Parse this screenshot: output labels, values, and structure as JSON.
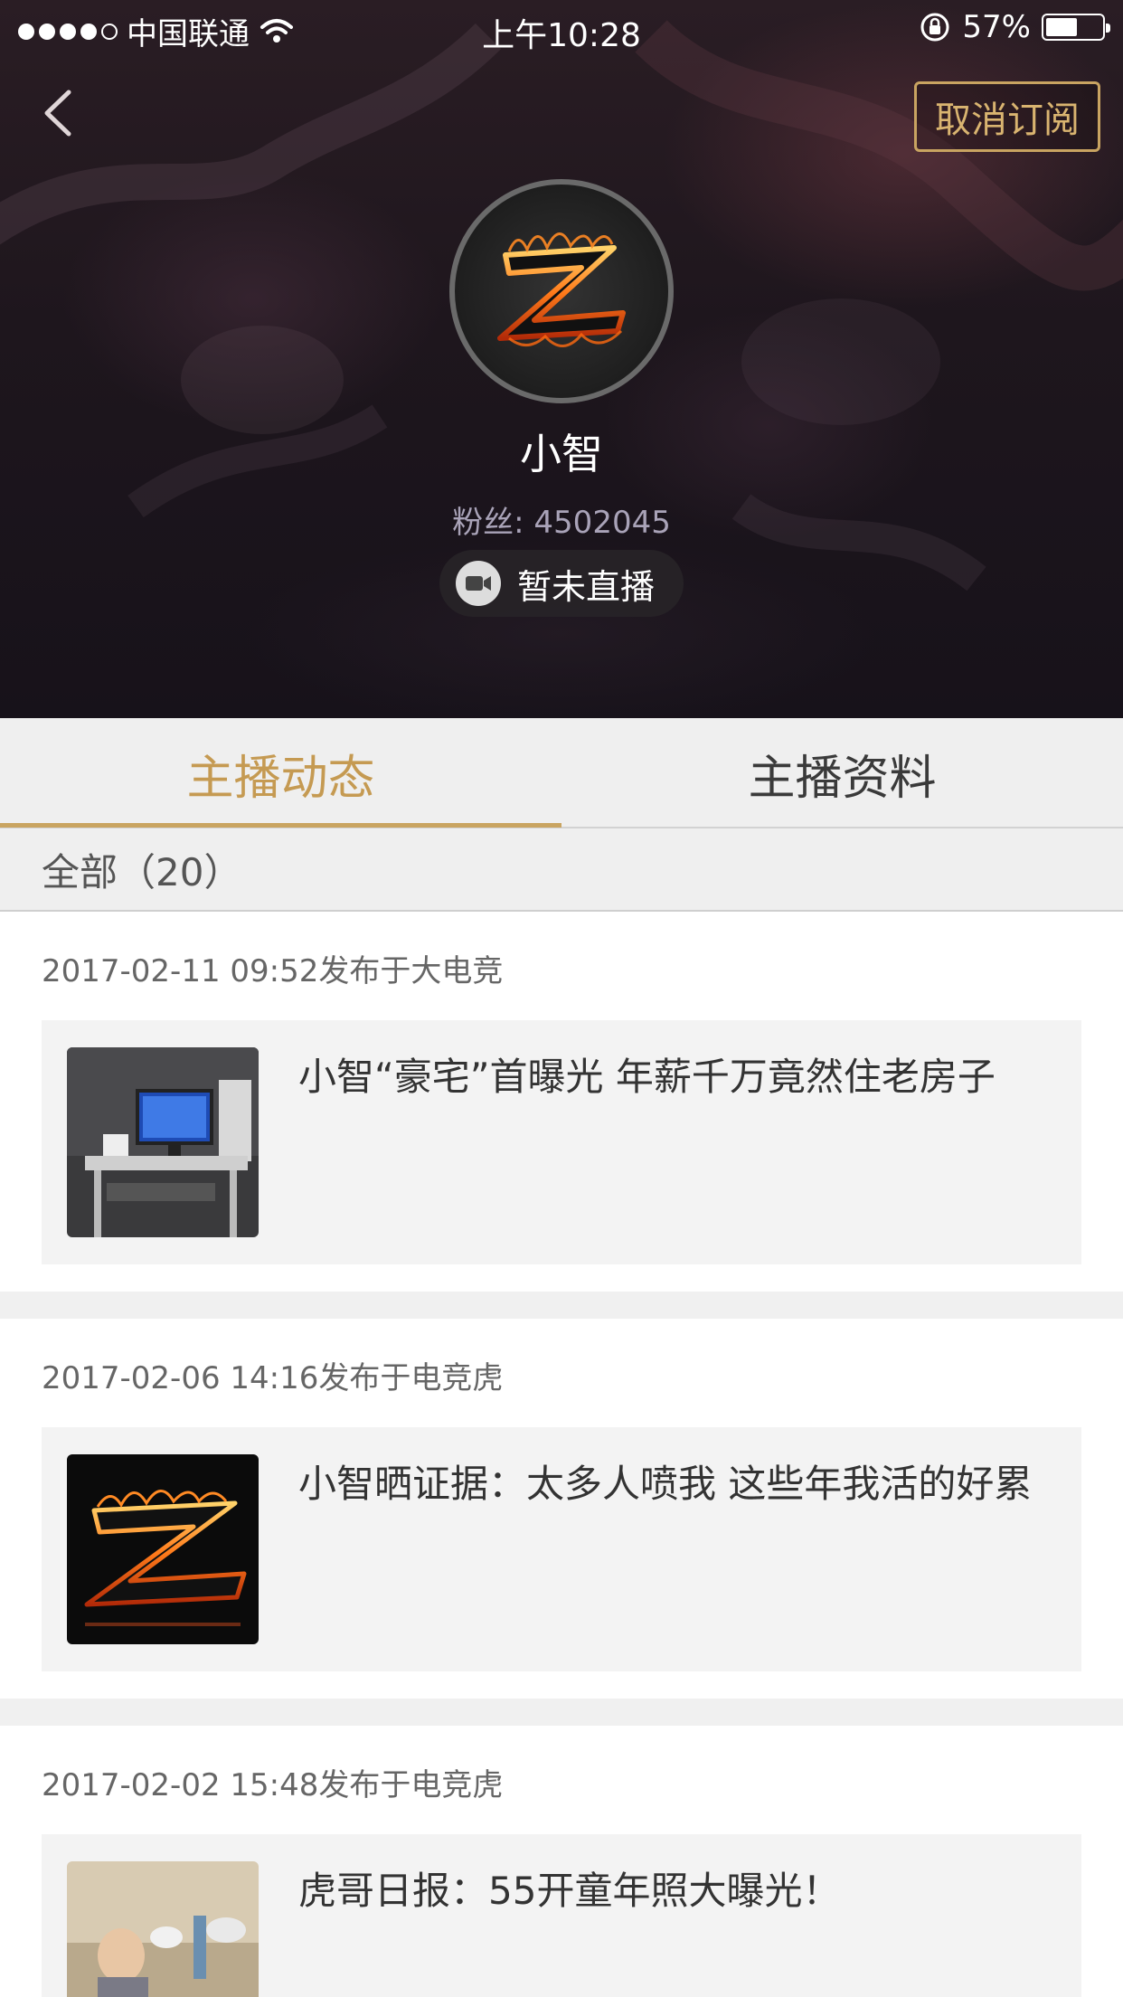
{
  "status_bar": {
    "carrier": "中国联通",
    "time": "上午10:28",
    "battery": "57%",
    "battery_level": 0.57,
    "icons": [
      "signal-dots",
      "wifi-icon",
      "rotation-lock-icon",
      "battery-icon"
    ]
  },
  "header": {
    "back_icon": "chevron-left-icon",
    "unsubscribe_label": "取消订阅",
    "accent_color": "#c9a461"
  },
  "profile": {
    "name": "小智",
    "fans": "粉丝: 4502045",
    "live_status": "暂未直播",
    "live_icon": "video-camera-icon"
  },
  "tabs": [
    {
      "label": "主播动态",
      "active": true
    },
    {
      "label": "主播资料",
      "active": false
    }
  ],
  "filter": {
    "label": "全部（20）"
  },
  "feed": [
    {
      "meta": "2017-02-11 09:52发布于大电竞",
      "title": "小智“豪宅”首曝光 年薪千万竟然住老房子",
      "thumb": "desk-computer-photo"
    },
    {
      "meta": "2017-02-06 14:16发布于电竞虎",
      "title": "小智晒证据：太多人喷我 这些年我活的好累",
      "thumb": "flaming-z-logo"
    },
    {
      "meta": "2017-02-02 15:48发布于电竞虎",
      "title": "虎哥日报：55开童年照大曝光！",
      "thumb": "child-photo"
    }
  ]
}
